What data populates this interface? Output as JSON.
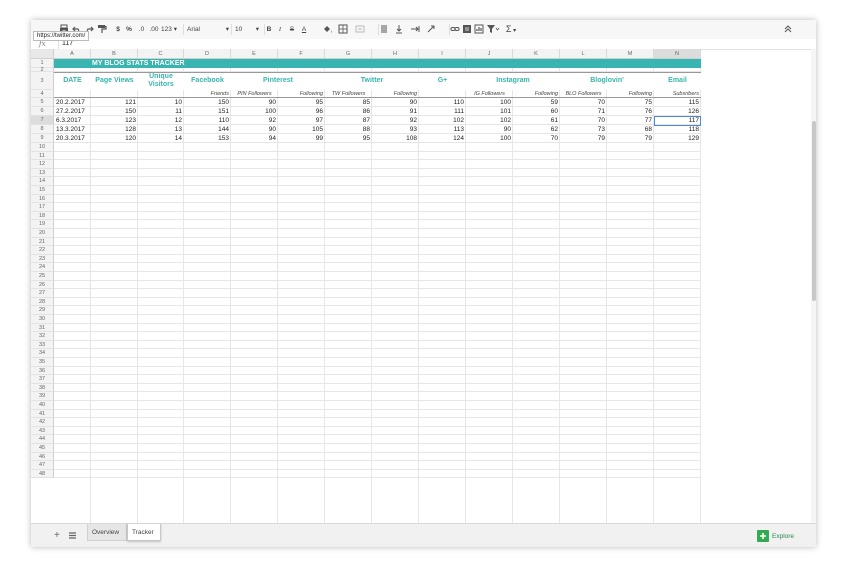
{
  "toolbar": {
    "currency": "$",
    "percent": "%",
    "decimal_less": ".0",
    "decimal_more": ".00",
    "more_formats": "123",
    "font": "Arial",
    "font_size": "10",
    "bold": "B",
    "italic": "I",
    "strike": "S",
    "text_color": "A",
    "sigma": "Σ",
    "tooltip": "https://twitter.com/"
  },
  "formula_bar": {
    "fx": "fx",
    "value": "117"
  },
  "columns": [
    "A",
    "B",
    "C",
    "D",
    "E",
    "F",
    "G",
    "H",
    "I",
    "J",
    "K",
    "L",
    "M",
    "N"
  ],
  "sheet": {
    "title": "MY BLOG STATS TRACKER",
    "headers": {
      "date": "DATE",
      "page_views": "Page Views",
      "unique_visitors": "Unique Visitors",
      "facebook": "Facebook",
      "pinterest": "Pinterest",
      "twitter": "Twitter",
      "gplus": "G+",
      "instagram": "Instagram",
      "bloglovin": "Bloglovin'",
      "email": "Email"
    },
    "subheaders": {
      "fb_friends": "Friends",
      "pin_followers": "PIN Followers",
      "pin_following": "Following",
      "tw_followers": "TW Followers",
      "tw_following": "Following",
      "ig_followers": "IG Followers",
      "ig_following": "Following",
      "blo_followers": "BLO Followers",
      "blo_following": "Following",
      "email_subs": "Subsribers"
    },
    "rows": [
      [
        "20.2.2017",
        "121",
        "10",
        "150",
        "90",
        "95",
        "85",
        "90",
        "110",
        "100",
        "59",
        "70",
        "75",
        "115"
      ],
      [
        "27.2.2017",
        "150",
        "11",
        "151",
        "100",
        "96",
        "86",
        "91",
        "111",
        "101",
        "60",
        "71",
        "76",
        "126"
      ],
      [
        "6.3.2017",
        "123",
        "12",
        "110",
        "92",
        "97",
        "87",
        "92",
        "102",
        "102",
        "61",
        "70",
        "77",
        "117"
      ],
      [
        "13.3.2017",
        "128",
        "13",
        "144",
        "90",
        "105",
        "88",
        "93",
        "113",
        "90",
        "62",
        "73",
        "68",
        "118"
      ],
      [
        "20.3.2017",
        "120",
        "14",
        "153",
        "94",
        "99",
        "95",
        "108",
        "124",
        "100",
        "70",
        "79",
        "79",
        "129"
      ]
    ]
  },
  "tabs": {
    "overview": "Overview",
    "tracker": "Tracker",
    "dropdown": "▾"
  },
  "explore": "Explore",
  "accent_color": "#38b5b0"
}
